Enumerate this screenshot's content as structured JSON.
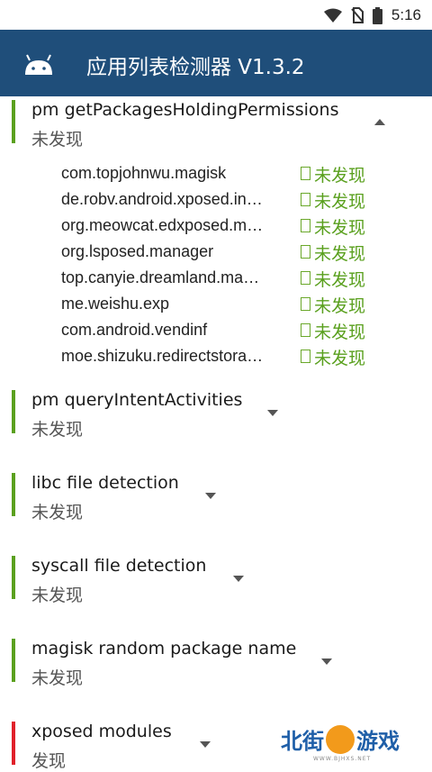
{
  "status_bar": {
    "time": "5:16"
  },
  "app": {
    "title": "应用列表检测器 V1.3.2"
  },
  "sections": [
    {
      "title": "pm getPackagesHoldingPermissions",
      "status": "未发现",
      "expanded": true,
      "packages": [
        {
          "name": "com.topjohnwu.magisk",
          "status": "未发现"
        },
        {
          "name": "de.robv.android.xposed.in…",
          "status": "未发现"
        },
        {
          "name": "org.meowcat.edxposed.m…",
          "status": "未发现"
        },
        {
          "name": "org.lsposed.manager",
          "status": "未发现"
        },
        {
          "name": "top.canyie.dreamland.ma…",
          "status": "未发现"
        },
        {
          "name": "me.weishu.exp",
          "status": "未发现"
        },
        {
          "name": "com.android.vendinf",
          "status": "未发现"
        },
        {
          "name": "moe.shizuku.redirectstora…",
          "status": "未发现"
        }
      ]
    },
    {
      "title": "pm queryIntentActivities",
      "status": "未发现",
      "expanded": false
    },
    {
      "title": "libc file detection",
      "status": "未发现",
      "expanded": false
    },
    {
      "title": "syscall file detection",
      "status": "未发现",
      "expanded": false
    },
    {
      "title": "magisk random package name",
      "status": "未发现",
      "expanded": false
    },
    {
      "title": "xposed modules",
      "status": "发现",
      "expanded": false
    }
  ],
  "colors": {
    "appbar": "#1f4e7a",
    "ok": "#5aa01e",
    "bad": "#e0202a"
  },
  "watermark": {
    "left": "北街",
    "right": "游戏",
    "url": "WWW.BJHXS.NET"
  }
}
